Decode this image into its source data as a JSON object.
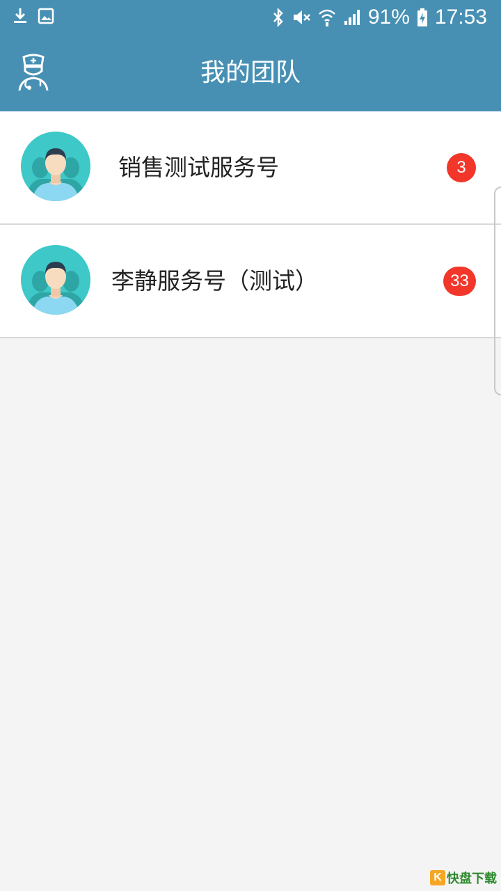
{
  "status_bar": {
    "icons_left": [
      "download-icon",
      "image-icon"
    ],
    "icons_right": [
      "bluetooth-icon",
      "mute-icon",
      "wifi-icon",
      "signal-icon",
      "battery-charging-icon"
    ],
    "battery": "91%",
    "time": "17:53"
  },
  "header": {
    "title": "我的团队",
    "logo_icon": "doctor-icon"
  },
  "team_list": [
    {
      "name": "销售测试服务号",
      "unread": "3",
      "avatar_icon": "user-avatar-icon"
    },
    {
      "name": "李静服务号（测试）",
      "unread": "33",
      "avatar_icon": "user-avatar-icon"
    }
  ],
  "watermark": {
    "letter": "K",
    "text": "快盘下载"
  },
  "colors": {
    "primary": "#4790b4",
    "badge": "#f2372a",
    "avatar_bg": "#3ec8c8",
    "background": "#f4f4f4"
  }
}
